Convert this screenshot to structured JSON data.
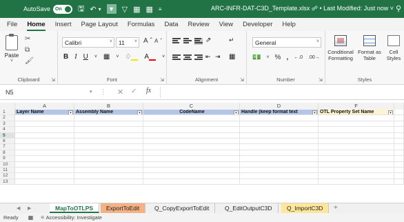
{
  "titlebar": {
    "autosave_label": "AutoSave",
    "autosave_state": "On",
    "doc_title": "ARC-INFR-DAT-C3D_Template.xlsx",
    "modified": "• Last Modified: Just now"
  },
  "menu": {
    "tabs": [
      "File",
      "Home",
      "Insert",
      "Page Layout",
      "Formulas",
      "Data",
      "Review",
      "View",
      "Developer",
      "Help"
    ],
    "active": "Home"
  },
  "ribbon": {
    "clipboard": {
      "paste_label": "Paste",
      "group_label": "Clipboard"
    },
    "font": {
      "name": "Calibri",
      "size": "11",
      "group_label": "Font"
    },
    "alignment": {
      "group_label": "Alignment"
    },
    "number": {
      "format": "General",
      "group_label": "Number"
    },
    "styles": {
      "cond_format": "Conditional Formatting",
      "format_table": "Format as Table",
      "cell_styles": "Cell Styles",
      "group_label": "Styles"
    }
  },
  "formulabar": {
    "namebox": "N5",
    "fx": "fx",
    "content": ""
  },
  "grid": {
    "columns": [
      "A",
      "B",
      "C",
      "D",
      "F"
    ],
    "headers": [
      {
        "col": "A",
        "text": "Layer Name"
      },
      {
        "col": "B",
        "text": "Assembly Name"
      },
      {
        "col": "C",
        "text": "CodeName"
      },
      {
        "col": "D",
        "text": "Handle (keep format text"
      },
      {
        "col": "F",
        "text": "OTL Property Set Name"
      }
    ],
    "row_numbers": [
      "1",
      "2",
      "3",
      "4",
      "5",
      "6",
      "7",
      "8",
      "9",
      "10",
      "11",
      "12",
      "13"
    ],
    "selected_row": "5"
  },
  "sheets": {
    "tabs": [
      "MapToOTLPS",
      "ExportToEdit",
      "Q_CopyExportToEdit",
      "Q_EditOutputC3D",
      "Q_ImportC3D"
    ],
    "active": "MapToOTLPS",
    "add_label": "+"
  },
  "status": {
    "ready": "Ready",
    "accessibility": "Accessibility: Investigate"
  }
}
